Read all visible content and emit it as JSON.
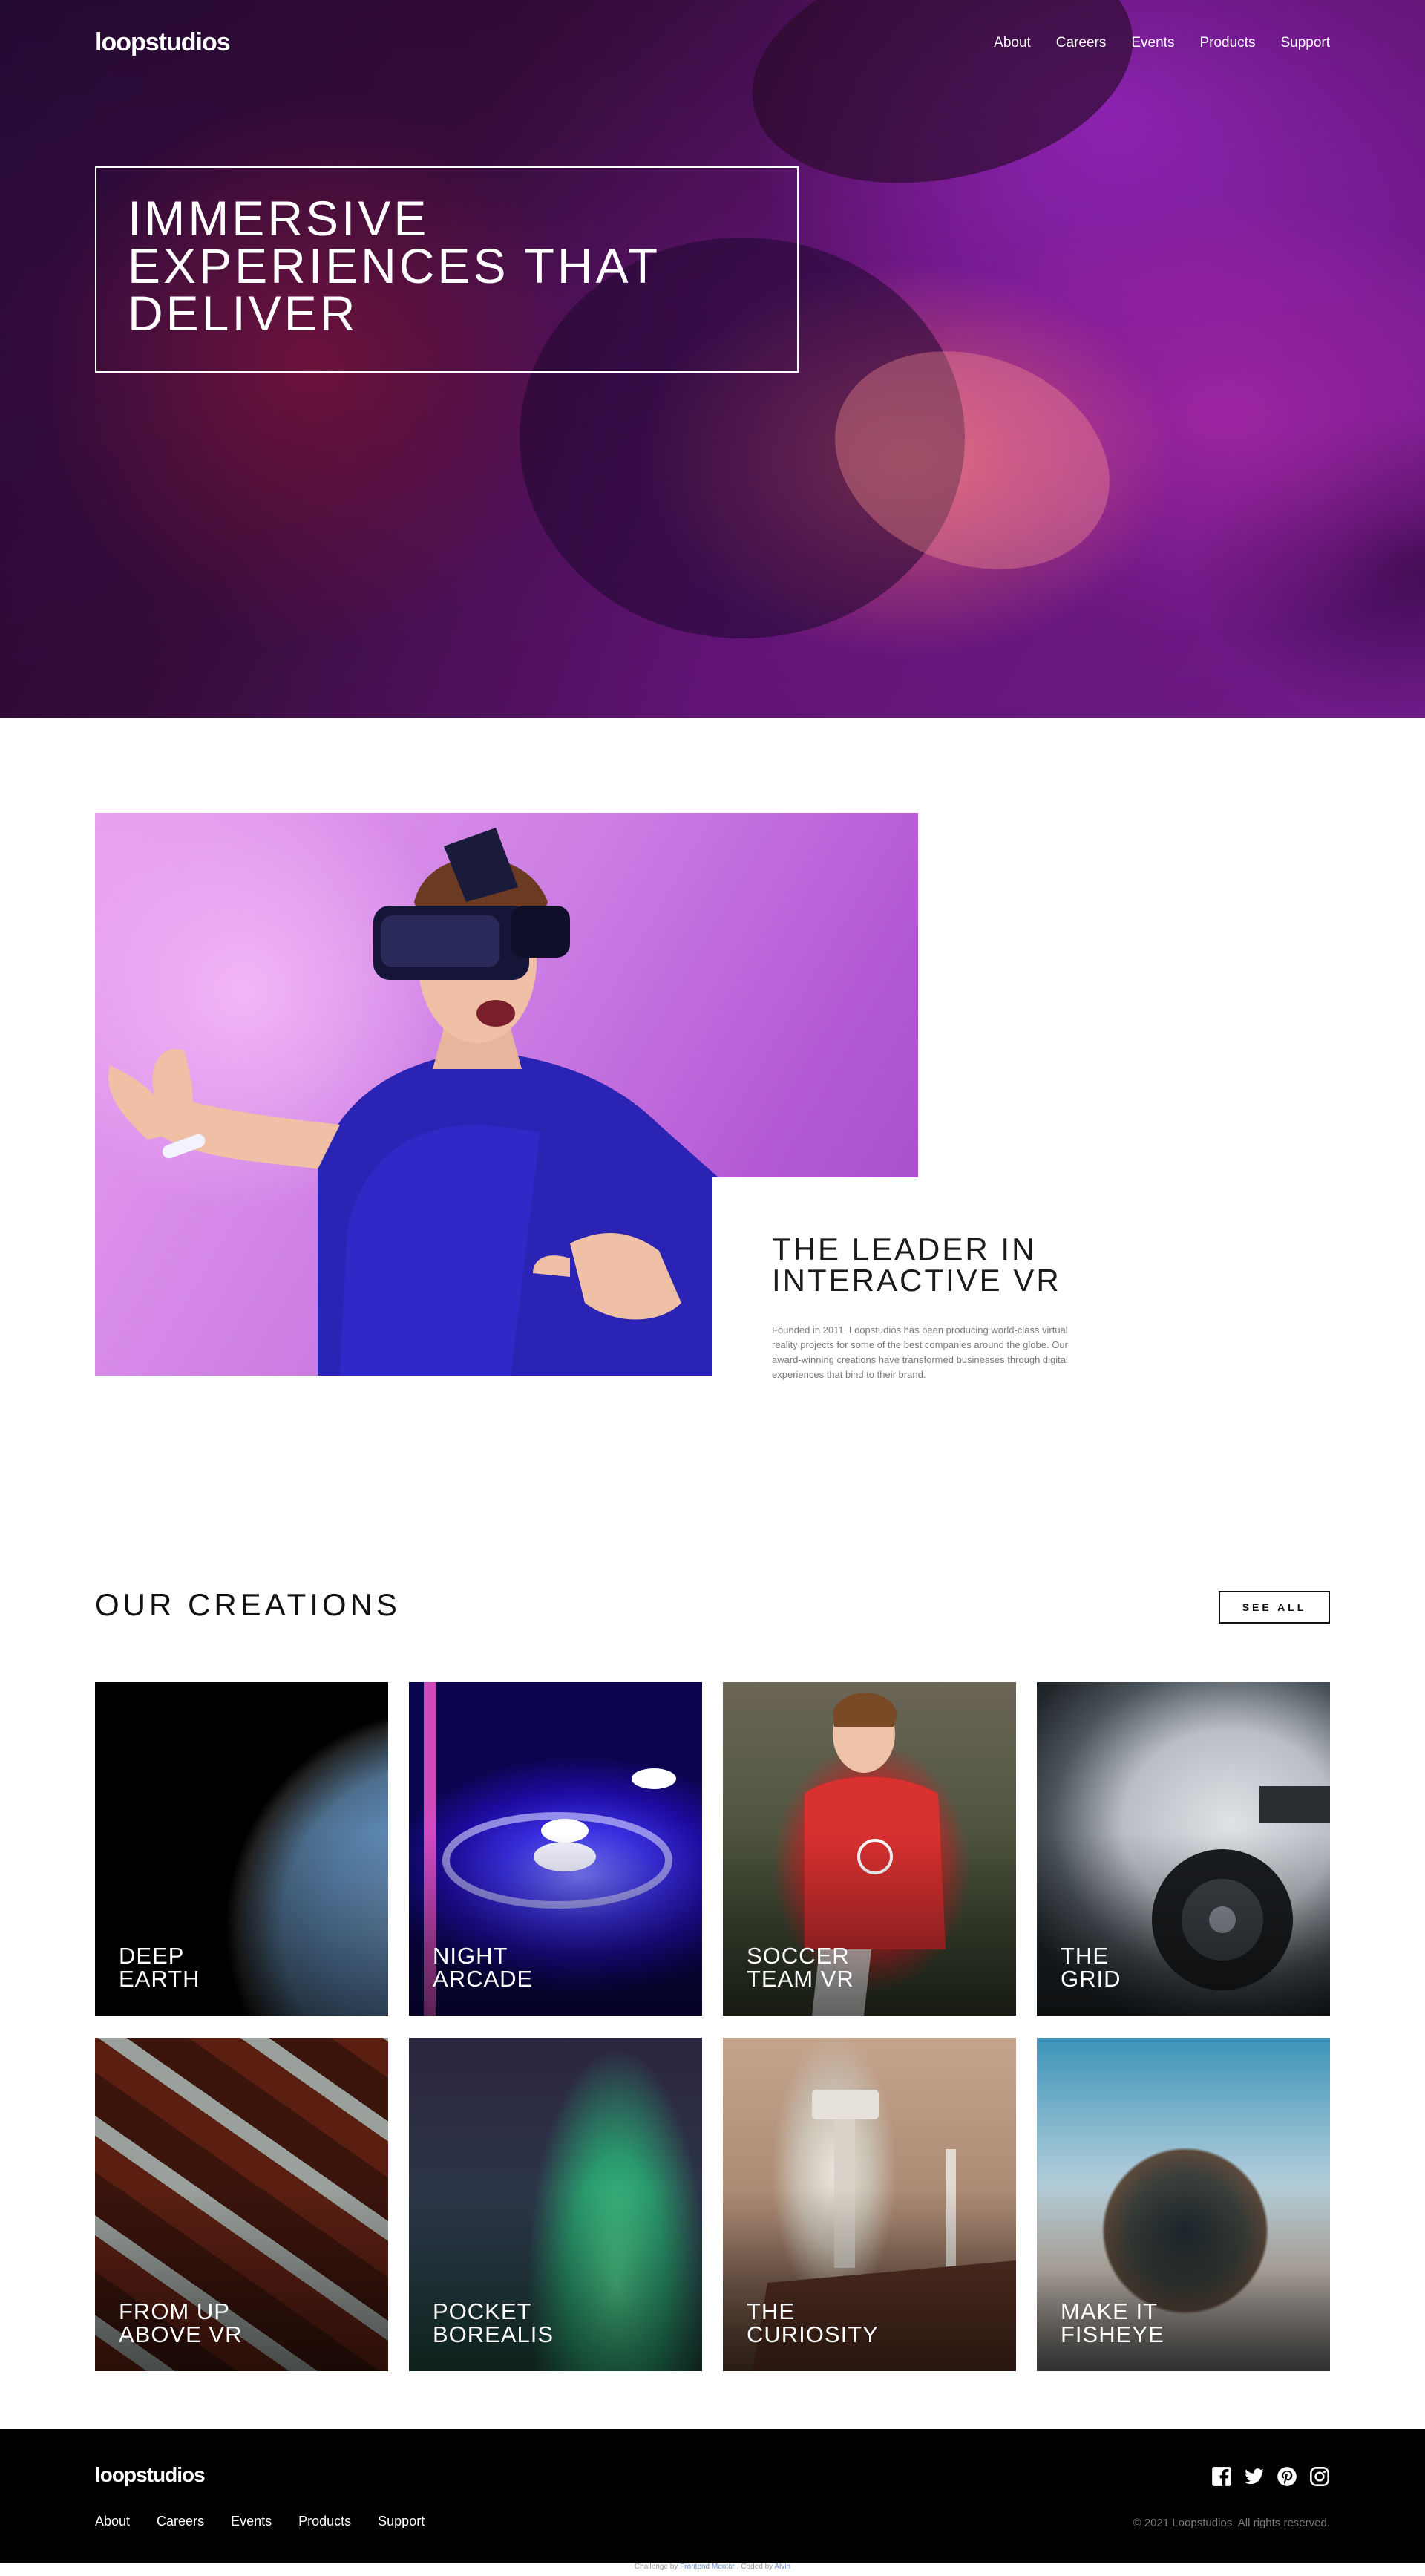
{
  "brand": {
    "logo": "loopstudios"
  },
  "nav": {
    "items": [
      "About",
      "Careers",
      "Events",
      "Products",
      "Support"
    ]
  },
  "hero": {
    "title_lines": [
      "Immersive",
      "experiences that",
      "deliver"
    ]
  },
  "intro": {
    "title_lines": [
      "The leader in",
      "interactive VR"
    ],
    "text": "Founded in 2011, Loopstudios has been producing world-class virtual reality projects for some of the best companies around the globe. Our award-winning creations have transformed businesses through digital experiences that bind to their brand."
  },
  "creations": {
    "heading": "Our creations",
    "see_all_label": "See all",
    "items": [
      {
        "title_lines": [
          "Deep",
          "earth"
        ]
      },
      {
        "title_lines": [
          "Night",
          "arcade"
        ]
      },
      {
        "title_lines": [
          "Soccer",
          "team VR"
        ]
      },
      {
        "title_lines": [
          "The",
          "grid"
        ]
      },
      {
        "title_lines": [
          "From up",
          "above VR"
        ]
      },
      {
        "title_lines": [
          "Pocket",
          "borealis"
        ]
      },
      {
        "title_lines": [
          "The",
          "curiosity"
        ]
      },
      {
        "title_lines": [
          "Make it",
          "fisheye"
        ]
      }
    ]
  },
  "footer": {
    "logo": "loopstudios",
    "nav": [
      "About",
      "Careers",
      "Events",
      "Products",
      "Support"
    ],
    "social_icons": [
      "facebook-icon",
      "twitter-icon",
      "pinterest-icon",
      "instagram-icon"
    ],
    "copyright": "© 2021 Loopstudios. All rights reserved."
  },
  "attribution": {
    "prefix": "Challenge by",
    "fm": "Frontend Mentor",
    "mid": ". Coded by",
    "author": "Alvin"
  }
}
